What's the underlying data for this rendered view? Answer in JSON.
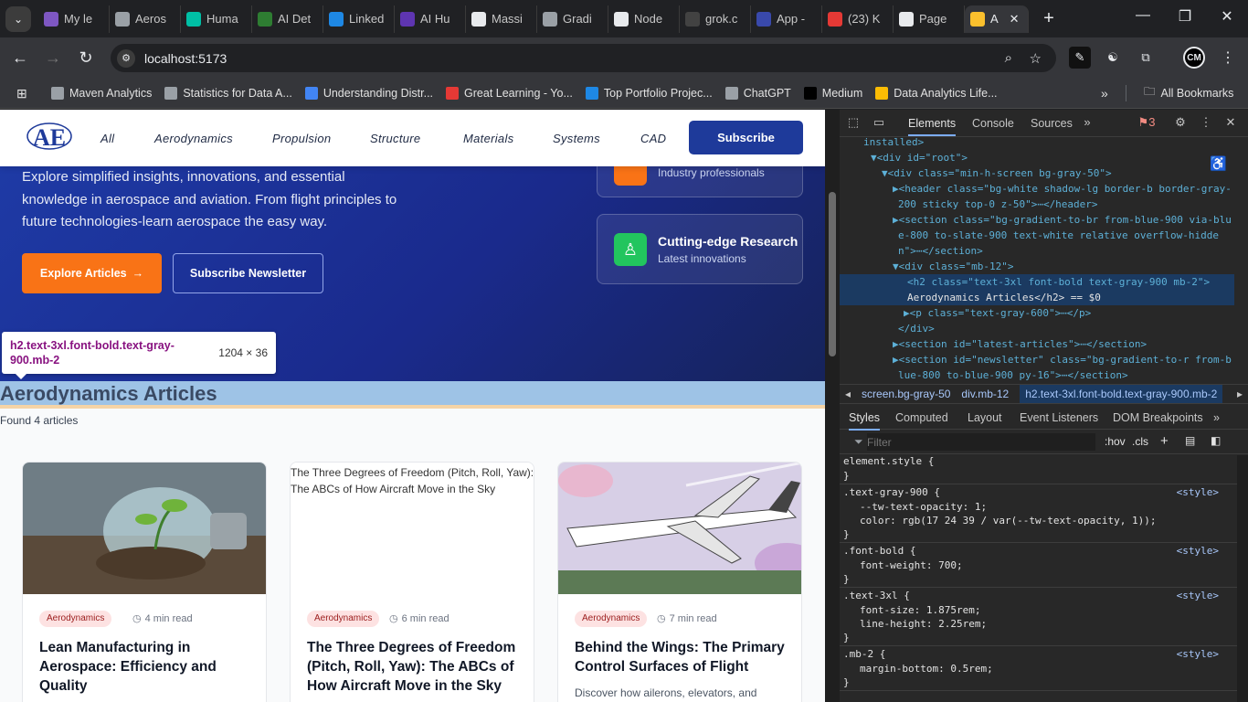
{
  "browser": {
    "tabs": [
      {
        "label": "My le",
        "color": "#7e57c2"
      },
      {
        "label": "Aeros",
        "color": "#9aa0a6"
      },
      {
        "label": "Huma",
        "color": "#00bfa5"
      },
      {
        "label": "AI Det",
        "color": "#2e7d32"
      },
      {
        "label": "Linked",
        "color": "#1e88e5"
      },
      {
        "label": "AI Hu",
        "color": "#5e35b1"
      },
      {
        "label": "Massi",
        "color": "#e8eaed"
      },
      {
        "label": "Gradi",
        "color": "#9aa0a6"
      },
      {
        "label": "Node",
        "color": "#e8eaed"
      },
      {
        "label": "grok.c",
        "color": "#424242"
      },
      {
        "label": "App -",
        "color": "#3949ab"
      },
      {
        "label": "(23) K",
        "color": "#e53935"
      },
      {
        "label": "Page",
        "color": "#e8eaed"
      },
      {
        "label": "A",
        "color": "#fbc02d"
      }
    ],
    "close_tab_symbol": "✕",
    "new_tab_symbol": "+",
    "url": "localhost:5173",
    "bookmarks": [
      {
        "label": "Maven Analytics",
        "color": "#9aa0a6"
      },
      {
        "label": "Statistics for Data A...",
        "color": "#9aa0a6"
      },
      {
        "label": "Understanding Distr...",
        "color": "#4285f4"
      },
      {
        "label": "Great Learning - Yo...",
        "color": "#e53935"
      },
      {
        "label": "Top Portfolio Projec...",
        "color": "#1e88e5"
      },
      {
        "label": "ChatGPT",
        "color": "#9aa0a6"
      },
      {
        "label": "Medium",
        "color": "#000000"
      },
      {
        "label": "Data Analytics Life...",
        "color": "#fbbc04"
      }
    ],
    "all_bookmarks_label": "All Bookmarks",
    "profile_initials": "CM"
  },
  "site": {
    "logo_text": "AE",
    "nav": [
      "All",
      "Aerodynamics",
      "Propulsion",
      "Structure",
      "Materials",
      "Systems",
      "CAD"
    ],
    "subscribe_label": "Subscribe"
  },
  "hero": {
    "text": "Explore simplified insights, innovations, and essential knowledge in aerospace and aviation. From flight principles to future technologies-learn aerospace the easy way.",
    "explore_label": "Explore Articles",
    "newsletter_label": "Subscribe Newsletter",
    "features": [
      {
        "title": "",
        "subtitle": "Industry professionals",
        "color": "#f97316"
      },
      {
        "title": "Cutting-edge Research",
        "subtitle": "Latest innovations",
        "color": "#22c55e"
      }
    ]
  },
  "inspector_tooltip": {
    "selector": "h2.text-3xl.font-bold.text-gray-900.mb-2",
    "dimensions": "1204 × 36"
  },
  "articles": {
    "heading": "Aerodynamics Articles",
    "count_text": "Found 4 articles",
    "cards": [
      {
        "tag": "Aerodynamics",
        "read_time": "4 min read",
        "title": "Lean Manufacturing in Aerospace: Efficiency and Quality",
        "image_alt": "",
        "description": ""
      },
      {
        "tag": "Aerodynamics",
        "read_time": "6 min read",
        "title": "The Three Degrees of Freedom (Pitch, Roll, Yaw): The ABCs of How Aircraft Move in the Sky",
        "image_alt": "The Three Degrees of Freedom (Pitch, Roll, Yaw): The ABCs of How Aircraft Move in the Sky",
        "description": ""
      },
      {
        "tag": "Aerodynamics",
        "read_time": "7 min read",
        "title": "Behind the Wings: The Primary Control Surfaces of Flight",
        "image_alt": "",
        "description": "Discover how ailerons, elevators, and"
      }
    ]
  },
  "devtools": {
    "tabs": [
      "Elements",
      "Console",
      "Sources"
    ],
    "issue_count": "3",
    "dom_lines": [
      {
        "text": "installed>"
      },
      {
        "text": "▼<div id=\"root\">"
      },
      {
        "text": "▼<div class=\"min-h-screen bg-gray-50\">"
      },
      {
        "text": "▶<header class=\"bg-white shadow-lg border-b border-gray-"
      },
      {
        "text": "200 sticky top-0 z-50\">⋯</header>"
      },
      {
        "text": "▶<section class=\"bg-gradient-to-br from-blue-900 via-blu"
      },
      {
        "text": "e-800 to-slate-900 text-white relative overflow-hidde"
      },
      {
        "text": "n\">⋯</section>"
      },
      {
        "text": "▼<div class=\"mb-12\">"
      },
      {
        "text": "<h2 class=\"text-3xl font-bold text-gray-900 mb-2\">"
      },
      {
        "text": "Aerodynamics Articles</h2> == $0"
      },
      {
        "text": "▶<p class=\"text-gray-600\">⋯</p>"
      },
      {
        "text": "</div>"
      },
      {
        "text": "▶<section id=\"latest-articles\">⋯</section>"
      },
      {
        "text": "▶<section id=\"newsletter\" class=\"bg-gradient-to-r from-b"
      },
      {
        "text": "lue-800 to-blue-900 py-16\">⋯</section>"
      }
    ],
    "breadcrumbs": [
      "screen.bg-gray-50",
      "div.mb-12",
      "h2.text-3xl.font-bold.text-gray-900.mb-2"
    ],
    "style_tabs": [
      "Styles",
      "Computed",
      "Layout",
      "Event Listeners",
      "DOM Breakpoints"
    ],
    "filter_placeholder": "Filter",
    "hov_label": ":hov",
    "cls_label": ".cls",
    "rules": [
      {
        "selector": "element.style {",
        "source": "",
        "props": []
      },
      {
        "selector": ".text-gray-900 {",
        "source": "<style>",
        "props": [
          "--tw-text-opacity: 1;",
          "color: rgb(17 24 39 / var(--tw-text-opacity, 1));"
        ]
      },
      {
        "selector": ".font-bold {",
        "source": "<style>",
        "props": [
          "font-weight: 700;"
        ]
      },
      {
        "selector": ".text-3xl {",
        "source": "<style>",
        "props": [
          "font-size: 1.875rem;",
          "line-height: 2.25rem;"
        ]
      },
      {
        "selector": ".mb-2 {",
        "source": "<style>",
        "props": [
          "margin-bottom: 0.5rem;"
        ]
      }
    ]
  }
}
